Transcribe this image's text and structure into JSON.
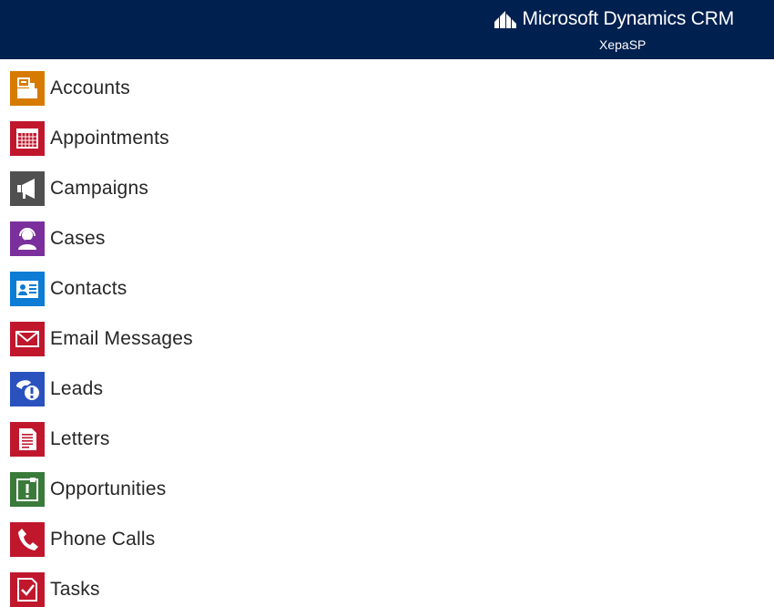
{
  "header": {
    "brand_text": "Microsoft Dynamics CRM",
    "org_name": "XepaSP",
    "background_color": "#002050"
  },
  "entities": [
    {
      "label": "Accounts",
      "icon": "accounts-icon",
      "color": "#D67A00"
    },
    {
      "label": "Appointments",
      "icon": "calendar-icon",
      "color": "#C0172D"
    },
    {
      "label": "Campaigns",
      "icon": "megaphone-icon",
      "color": "#505050"
    },
    {
      "label": "Cases",
      "icon": "support-agent-icon",
      "color": "#7A2F9C"
    },
    {
      "label": "Contacts",
      "icon": "contact-card-icon",
      "color": "#0C7CD5"
    },
    {
      "label": "Email Messages",
      "icon": "envelope-icon",
      "color": "#C0172D"
    },
    {
      "label": "Leads",
      "icon": "phone-alert-icon",
      "color": "#2A52BE"
    },
    {
      "label": "Letters",
      "icon": "letter-icon",
      "color": "#C0172D"
    },
    {
      "label": "Opportunities",
      "icon": "opportunity-icon",
      "color": "#3A7A3A"
    },
    {
      "label": "Phone Calls",
      "icon": "phone-icon",
      "color": "#C0172D"
    },
    {
      "label": "Tasks",
      "icon": "task-check-icon",
      "color": "#C0172D"
    }
  ]
}
